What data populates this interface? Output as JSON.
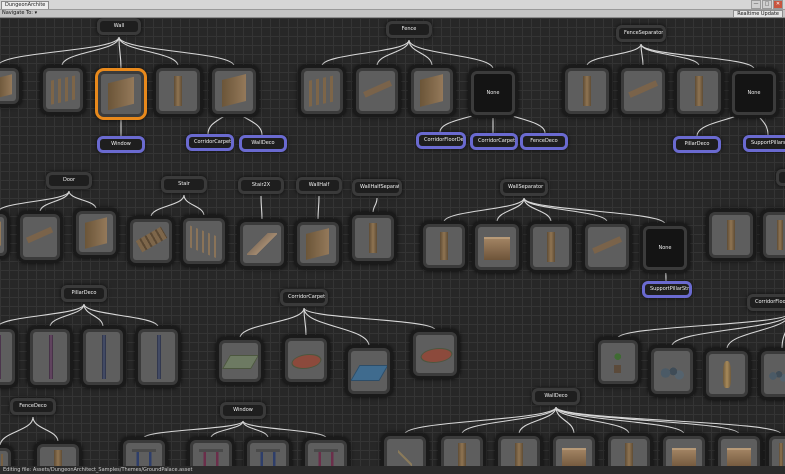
{
  "window": {
    "tab_label": "DungeonArchite",
    "min_glyph": "—",
    "max_glyph": "□",
    "close_glyph": "✕"
  },
  "toolbar": {
    "navigate_label": "Navigate To:",
    "navigate_arrow": "▾",
    "update_label": "Realtime Update"
  },
  "status": {
    "editing_text": "Editing file: Assets/DungeonArchitect_Samples/Themes/GroundPalace.asset"
  },
  "labels": {
    "none": "None",
    "wall": "Wall",
    "fence": "Fence",
    "fence_separator": "FenceSeparator",
    "window": "Window",
    "corridor_carpets": "CorridorCarpets",
    "wall_deco": "WallDeco",
    "corridor_floor_deco": "CorridorFloorDeco",
    "fence_deco": "FenceDeco",
    "pillar_deco": "PillarDeco",
    "support_pillars": "SupportPillars",
    "door": "Door",
    "stair": "Stair",
    "stair_2x": "Stair2X",
    "wall_half": "WallHalf",
    "wall_half_separator": "WallHalfSeparator",
    "wall_separator": "WallSeparator",
    "support_pillar_stron": "SupportPillarStron",
    "corridor_floor_d": "CorridorFloorD"
  },
  "colors": {
    "canvas_bg": "#272727",
    "selection": "#e8891c",
    "marker_emitter": "#6a6ad0",
    "link": "#d8d8d8"
  }
}
